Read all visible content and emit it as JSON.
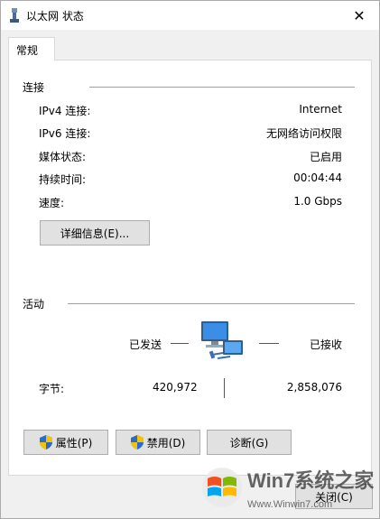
{
  "window": {
    "title": "以太网 状态",
    "close_glyph": "✕"
  },
  "tab": {
    "label": "常规"
  },
  "connection": {
    "heading": "连接",
    "rows": [
      {
        "label": "IPv4 连接:",
        "value": "Internet"
      },
      {
        "label": "IPv6 连接:",
        "value": "无网络访问权限"
      },
      {
        "label": "媒体状态:",
        "value": "已启用"
      },
      {
        "label": "持续时间:",
        "value": "00:04:44"
      },
      {
        "label": "速度:",
        "value": "1.0 Gbps"
      }
    ],
    "details_button": "详细信息(E)..."
  },
  "activity": {
    "heading": "活动",
    "sent_label": "已发送",
    "received_label": "已接收",
    "bytes_label": "字节:",
    "bytes_sent": "420,972",
    "bytes_received": "2,858,076"
  },
  "buttons": {
    "properties": "属性(P)",
    "disable": "禁用(D)",
    "diagnose": "诊断(G)",
    "close": "关闭(C)"
  },
  "watermark": {
    "brand": "Win7系统之家",
    "url": "Www.Winwin7.com"
  },
  "colors": {
    "shield_blue": "#2b6cc4",
    "shield_yellow": "#f4c20d",
    "monitor_blue": "#3a8ee6"
  }
}
